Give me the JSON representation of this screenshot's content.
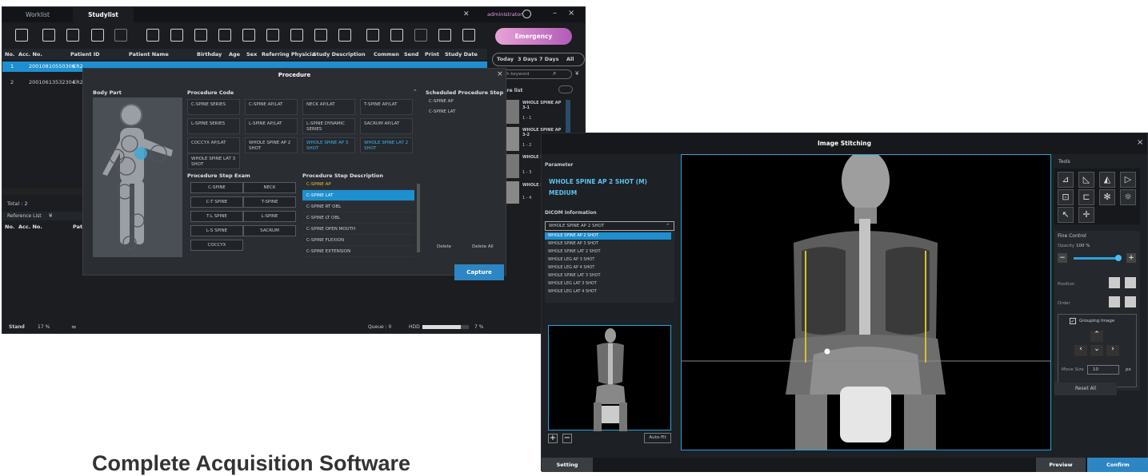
{
  "app1": {
    "tabs": [
      "Worklist",
      "Studylist"
    ],
    "user": "administrator",
    "emergency": "Emergency",
    "columns": [
      "No.",
      "Acc. No.",
      "Patient ID",
      "Patient Name",
      "Birthday",
      "Age",
      "Sex",
      "Referring Physicia",
      "Study Description",
      "Commen",
      "Send",
      "Print",
      "Study Date"
    ],
    "rows": [
      {
        "no": "1",
        "acc": "20010810550306",
        "pid": "ER2"
      },
      {
        "no": "2",
        "acc": "20010613532304",
        "pid": "ER2"
      }
    ],
    "date_filters": [
      "Today",
      "3 Days",
      "7 Days",
      "All"
    ],
    "search_placeholder": "rch keyword",
    "procedure_list_label": "edure list",
    "thumbnails": [
      {
        "title": "WHOLE SPINE AP 3-1",
        "sub": "1 - 1"
      },
      {
        "title": "WHOLE SPINE AP 3-2",
        "sub": "1 - 2"
      },
      {
        "title": "WHOLE S 3-3",
        "sub": "1 - 3"
      },
      {
        "title": "WHOLE S",
        "sub": "1 - 4"
      }
    ],
    "total": "Total : 2",
    "reference_list": "Reference List",
    "ref_columns": [
      "No.",
      "Acc. No.",
      "Pat"
    ],
    "status": {
      "stand": "Stand",
      "battery": "17 %",
      "queue": "Queue : 0",
      "hdd": "HDD",
      "hdd_pct": "7 %",
      "brand": "Xr",
      "hdd_fill": 0.82
    }
  },
  "procedure": {
    "title": "Procedure",
    "body_part": "Body Part",
    "code_header": "Procedure Code",
    "codes": [
      "C-SPINE SERIES",
      "C-SPINE AP/LAT",
      "NECK AP/LAT",
      "T-SPINE AP/LAT",
      "L-SPINE SERIES",
      "L-SPINE AP/LAT",
      "L-SPINE DYNAMIC SERIES",
      "SACRUM AP/LAT",
      "COCCYX AP/LAT",
      "WHOLE SPINE AP 2 SHOT",
      "WHOLE SPINE AP 3 SHOT",
      "WHOLE SPINE LAT 2 SHOT",
      "WHOLE SPINE LAT 3 SHOT"
    ],
    "step_exam_header": "Procedure Step Exam",
    "exams": [
      "C-SPINE",
      "NECK",
      "C-T SPINE",
      "T-SPINE",
      "T-L SPINE",
      "L-SPINE",
      "L-S SPINE",
      "SACRUM",
      "COCCYX"
    ],
    "desc_header": "Procedure Step Description",
    "descs": [
      "C-SPINE AP",
      "C-SPINE LAT",
      "C-SPINE RT OBL",
      "C-SPINE LT OBL",
      "C-SPINE OPEN MOUTH",
      "C-SPINE FLEXION",
      "C-SPINE EXTENSION"
    ],
    "scheduled_header": "Scheduled Procedure Step",
    "scheduled": [
      "C-SPINE AP",
      "C-SPINE LAT"
    ],
    "delete": "Delete",
    "delete_all": "Delete All",
    "capture": "Capture"
  },
  "stitch": {
    "title": "Image Stitching",
    "parameter": "Parameter",
    "param_name": "WHOLE SPINE AP 2 SHOT (M)",
    "param_size": "MEDIUM",
    "dicom_label": "DICOM Information",
    "dicom_selected": "WHOLE SPINE AP 2 SHOT",
    "dicom_options": [
      "WHOLE SPINE AP 2 SHOT",
      "WHOLE SPINE AP 3 SHOT",
      "WHOLE SPINE LAT 2 SHOT",
      "WHOLE LEG AP 3 SHOT",
      "WHOLE LEG AP 4 SHOT",
      "WHOLE SPINE LAT 3 SHOT",
      "WHOLE LEG LAT 3 SHOT",
      "WHOLE LEG LAT 4 SHOT"
    ],
    "auto_fit": "Auto-Fit",
    "tools": "Tools",
    "fine_control": "Fine Control",
    "opacity_label": "Opacity",
    "opacity_value": "100 %",
    "opacity": 1.0,
    "position": "Position",
    "order": "Order",
    "grouping": "Grouping Image",
    "move_size_label": "Move Size",
    "move_size": "10",
    "px": "px",
    "reset_all": "Reset All",
    "setting": "Setting",
    "preview": "Preview",
    "confirm": "Confirm"
  },
  "caption": "Complete Acquisition Software"
}
